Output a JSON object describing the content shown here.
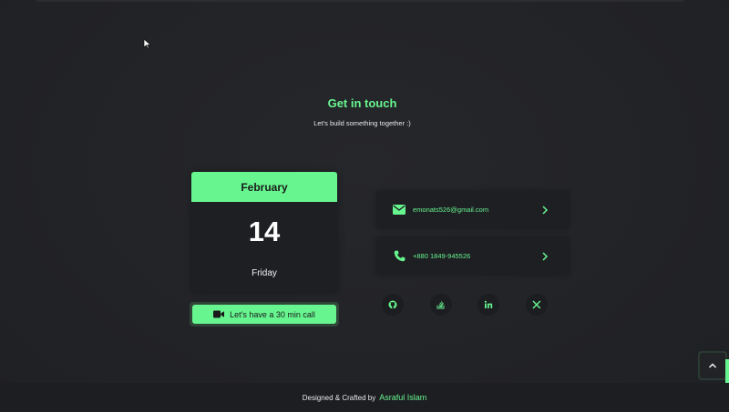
{
  "section": {
    "title": "Get in touch",
    "subtitle": "Let's build something together :)"
  },
  "calendar": {
    "month": "February",
    "day": "14",
    "weekday": "Friday",
    "call_button_label": "Let's have a 30 min call"
  },
  "contacts": [
    {
      "icon": "envelope-icon",
      "text": "emonats526@gmail.com"
    },
    {
      "icon": "phone-icon",
      "text": "+880 1849-945526"
    }
  ],
  "socials": [
    "github-icon",
    "stackoverflow-icon",
    "linkedin-icon",
    "x-icon"
  ],
  "footer": {
    "prefix": "Designed & Crafted by",
    "author": "Asraful Islam"
  },
  "colors": {
    "accent": "#67f58f",
    "background": "#222327",
    "card": "#1e1f23"
  }
}
